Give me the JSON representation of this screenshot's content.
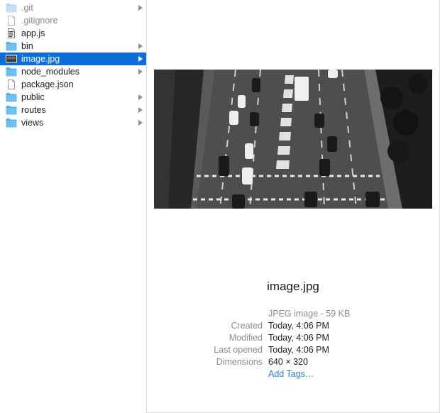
{
  "file_list": [
    {
      "name": ".git",
      "type": "folder",
      "dim": true,
      "has_children": true,
      "selected": false
    },
    {
      "name": ".gitignore",
      "type": "file-blank",
      "dim": true,
      "has_children": false,
      "selected": false
    },
    {
      "name": "app.js",
      "type": "file-script",
      "dim": false,
      "has_children": false,
      "selected": false
    },
    {
      "name": "bin",
      "type": "folder",
      "dim": false,
      "has_children": true,
      "selected": false
    },
    {
      "name": "image.jpg",
      "type": "file-image",
      "dim": false,
      "has_children": true,
      "selected": true
    },
    {
      "name": "node_modules",
      "type": "folder",
      "dim": false,
      "has_children": true,
      "selected": false
    },
    {
      "name": "package.json",
      "type": "file-blank",
      "dim": false,
      "has_children": false,
      "selected": false
    },
    {
      "name": "public",
      "type": "folder",
      "dim": false,
      "has_children": true,
      "selected": false
    },
    {
      "name": "routes",
      "type": "folder",
      "dim": false,
      "has_children": true,
      "selected": false
    },
    {
      "name": "views",
      "type": "folder",
      "dim": false,
      "has_children": true,
      "selected": false
    }
  ],
  "preview": {
    "image_icon": "street-traffic-photo",
    "filename": "image.jpg",
    "kind": "JPEG image - 59 KB",
    "info": [
      {
        "key": "Created",
        "value": "Today, 4:06 PM"
      },
      {
        "key": "Modified",
        "value": "Today, 4:06 PM"
      },
      {
        "key": "Last opened",
        "value": "Today, 4:06 PM"
      },
      {
        "key": "Dimensions",
        "value": "640 × 320"
      }
    ],
    "add_tags": "Add Tags…"
  },
  "colors": {
    "selection": "#0f6ddb",
    "folder": "#6cc0ef",
    "link": "#2f7be0",
    "secondary_text": "#8c8c8c"
  }
}
